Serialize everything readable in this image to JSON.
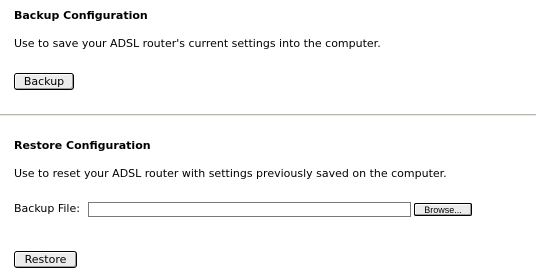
{
  "backup": {
    "heading": "Backup Configuration",
    "description": "Use to save your ADSL router's current settings into the computer.",
    "button_label": "Backup"
  },
  "restore": {
    "heading": "Restore Configuration",
    "description": "Use to reset your ADSL router with settings previously saved on the computer.",
    "file_label": "Backup File:",
    "file_value": "",
    "browse_label": "Browse...",
    "button_label": "Restore"
  }
}
